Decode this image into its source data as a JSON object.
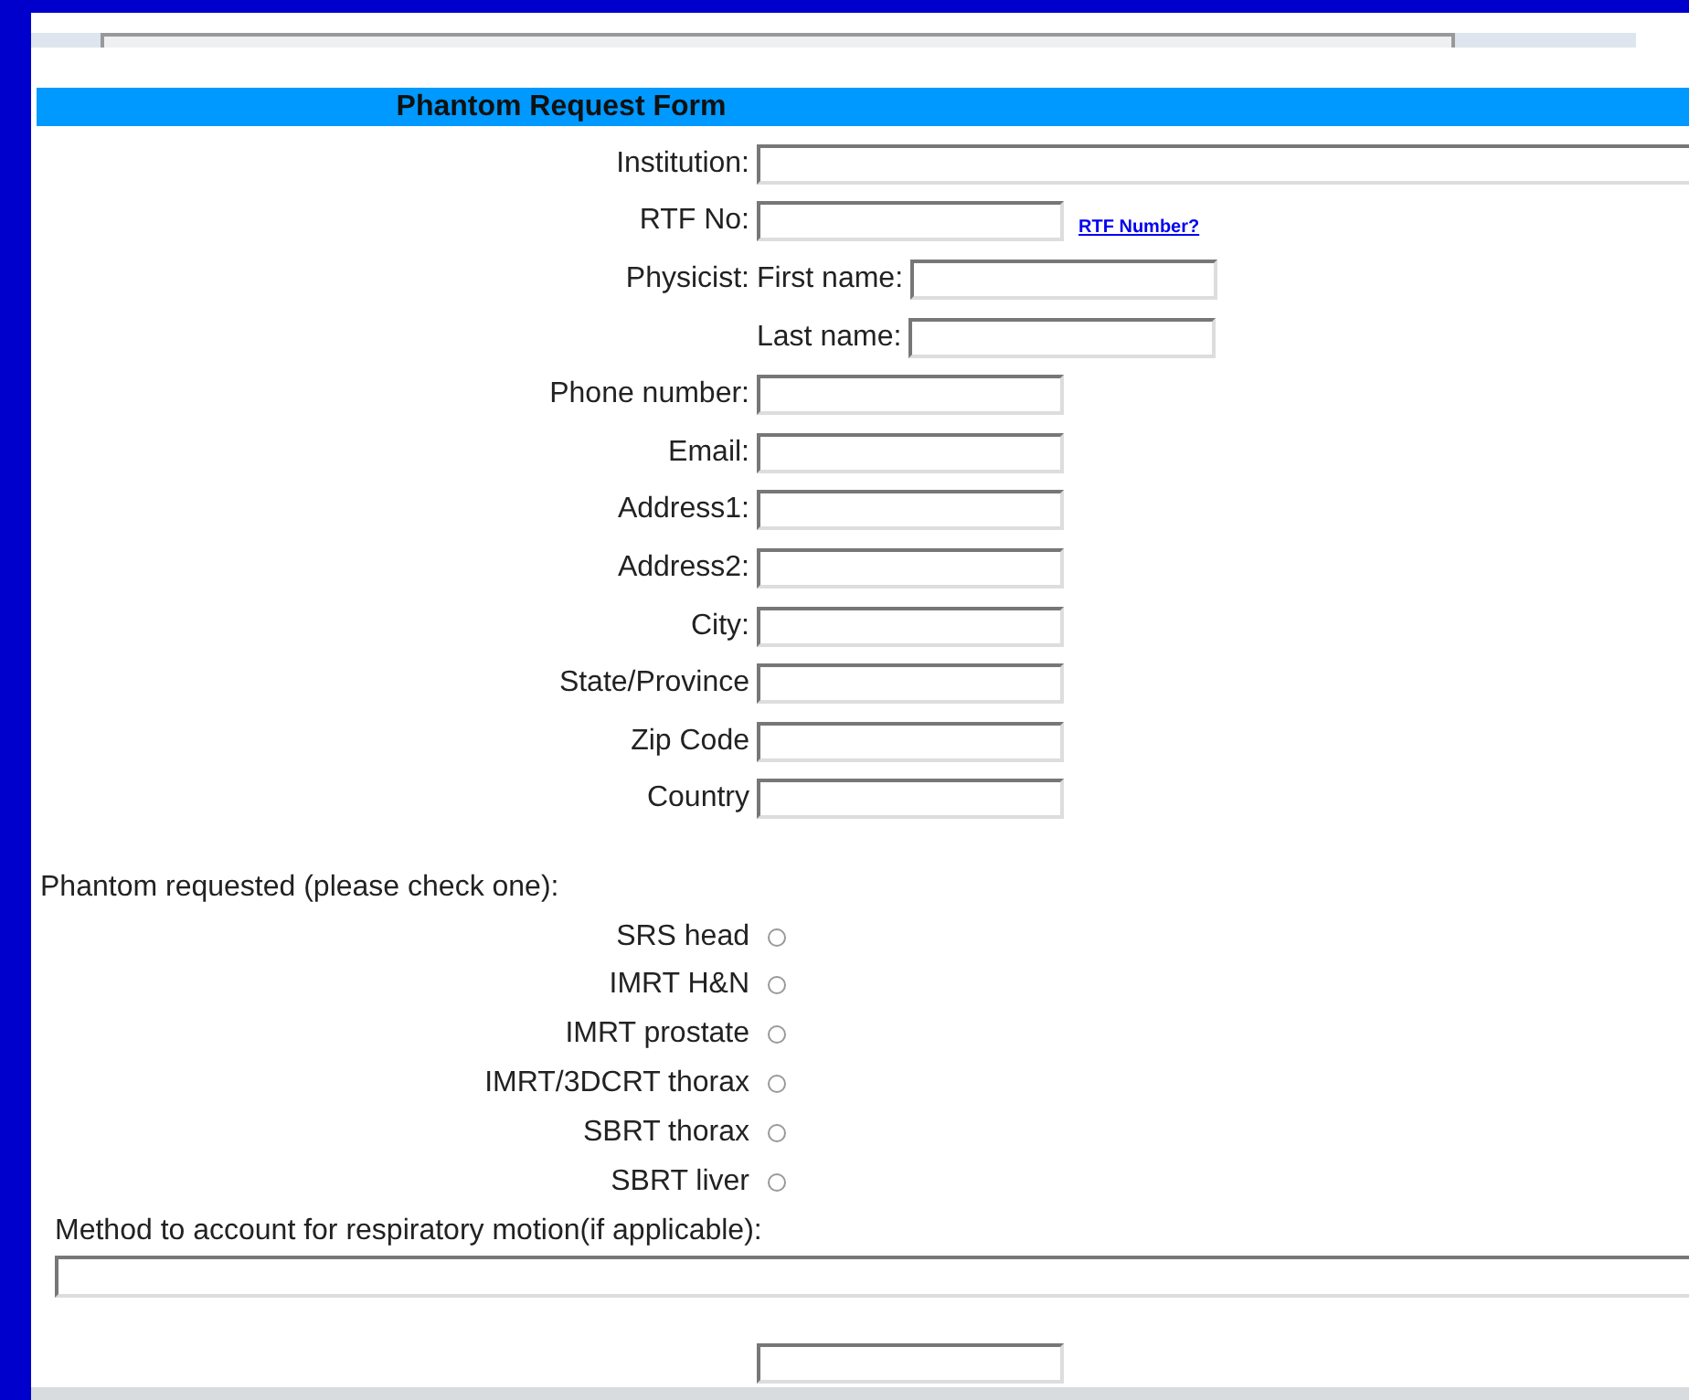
{
  "form": {
    "title": "Phantom Request Form",
    "fields": [
      {
        "kind": "wide",
        "label": "Institution:"
      },
      {
        "kind": "text",
        "label": "RTF No:",
        "link": "RTF Number?"
      },
      {
        "kind": "split",
        "label": "Physicist:",
        "sublabel": "First name:"
      },
      {
        "kind": "sub",
        "sublabel": "Last name:"
      },
      {
        "kind": "text",
        "label": "Phone number:"
      },
      {
        "kind": "text",
        "label": "Email:"
      },
      {
        "kind": "text",
        "label": "Address1:"
      },
      {
        "kind": "text",
        "label": "Address2:"
      },
      {
        "kind": "text",
        "label": "City:"
      },
      {
        "kind": "text",
        "label": "State/Province"
      },
      {
        "kind": "text",
        "label": "Zip Code"
      },
      {
        "kind": "text",
        "label": "Country"
      }
    ],
    "phantoms": {
      "prompt": "Phantom requested (please check one):",
      "options": [
        {
          "label": "SRS head",
          "selected": false
        },
        {
          "label": "IMRT H&N",
          "selected": false
        },
        {
          "label": "IMRT prostate",
          "selected": false
        },
        {
          "label": "IMRT/3DCRT thorax",
          "selected": false
        },
        {
          "label": "SBRT thorax",
          "selected": false
        },
        {
          "label": "SBRT liver",
          "selected": false
        }
      ]
    },
    "motion": {
      "label": "Method to account for respiratory motion(if applicable):"
    },
    "trailing_fields": [
      {
        "kind": "text"
      }
    ]
  }
}
